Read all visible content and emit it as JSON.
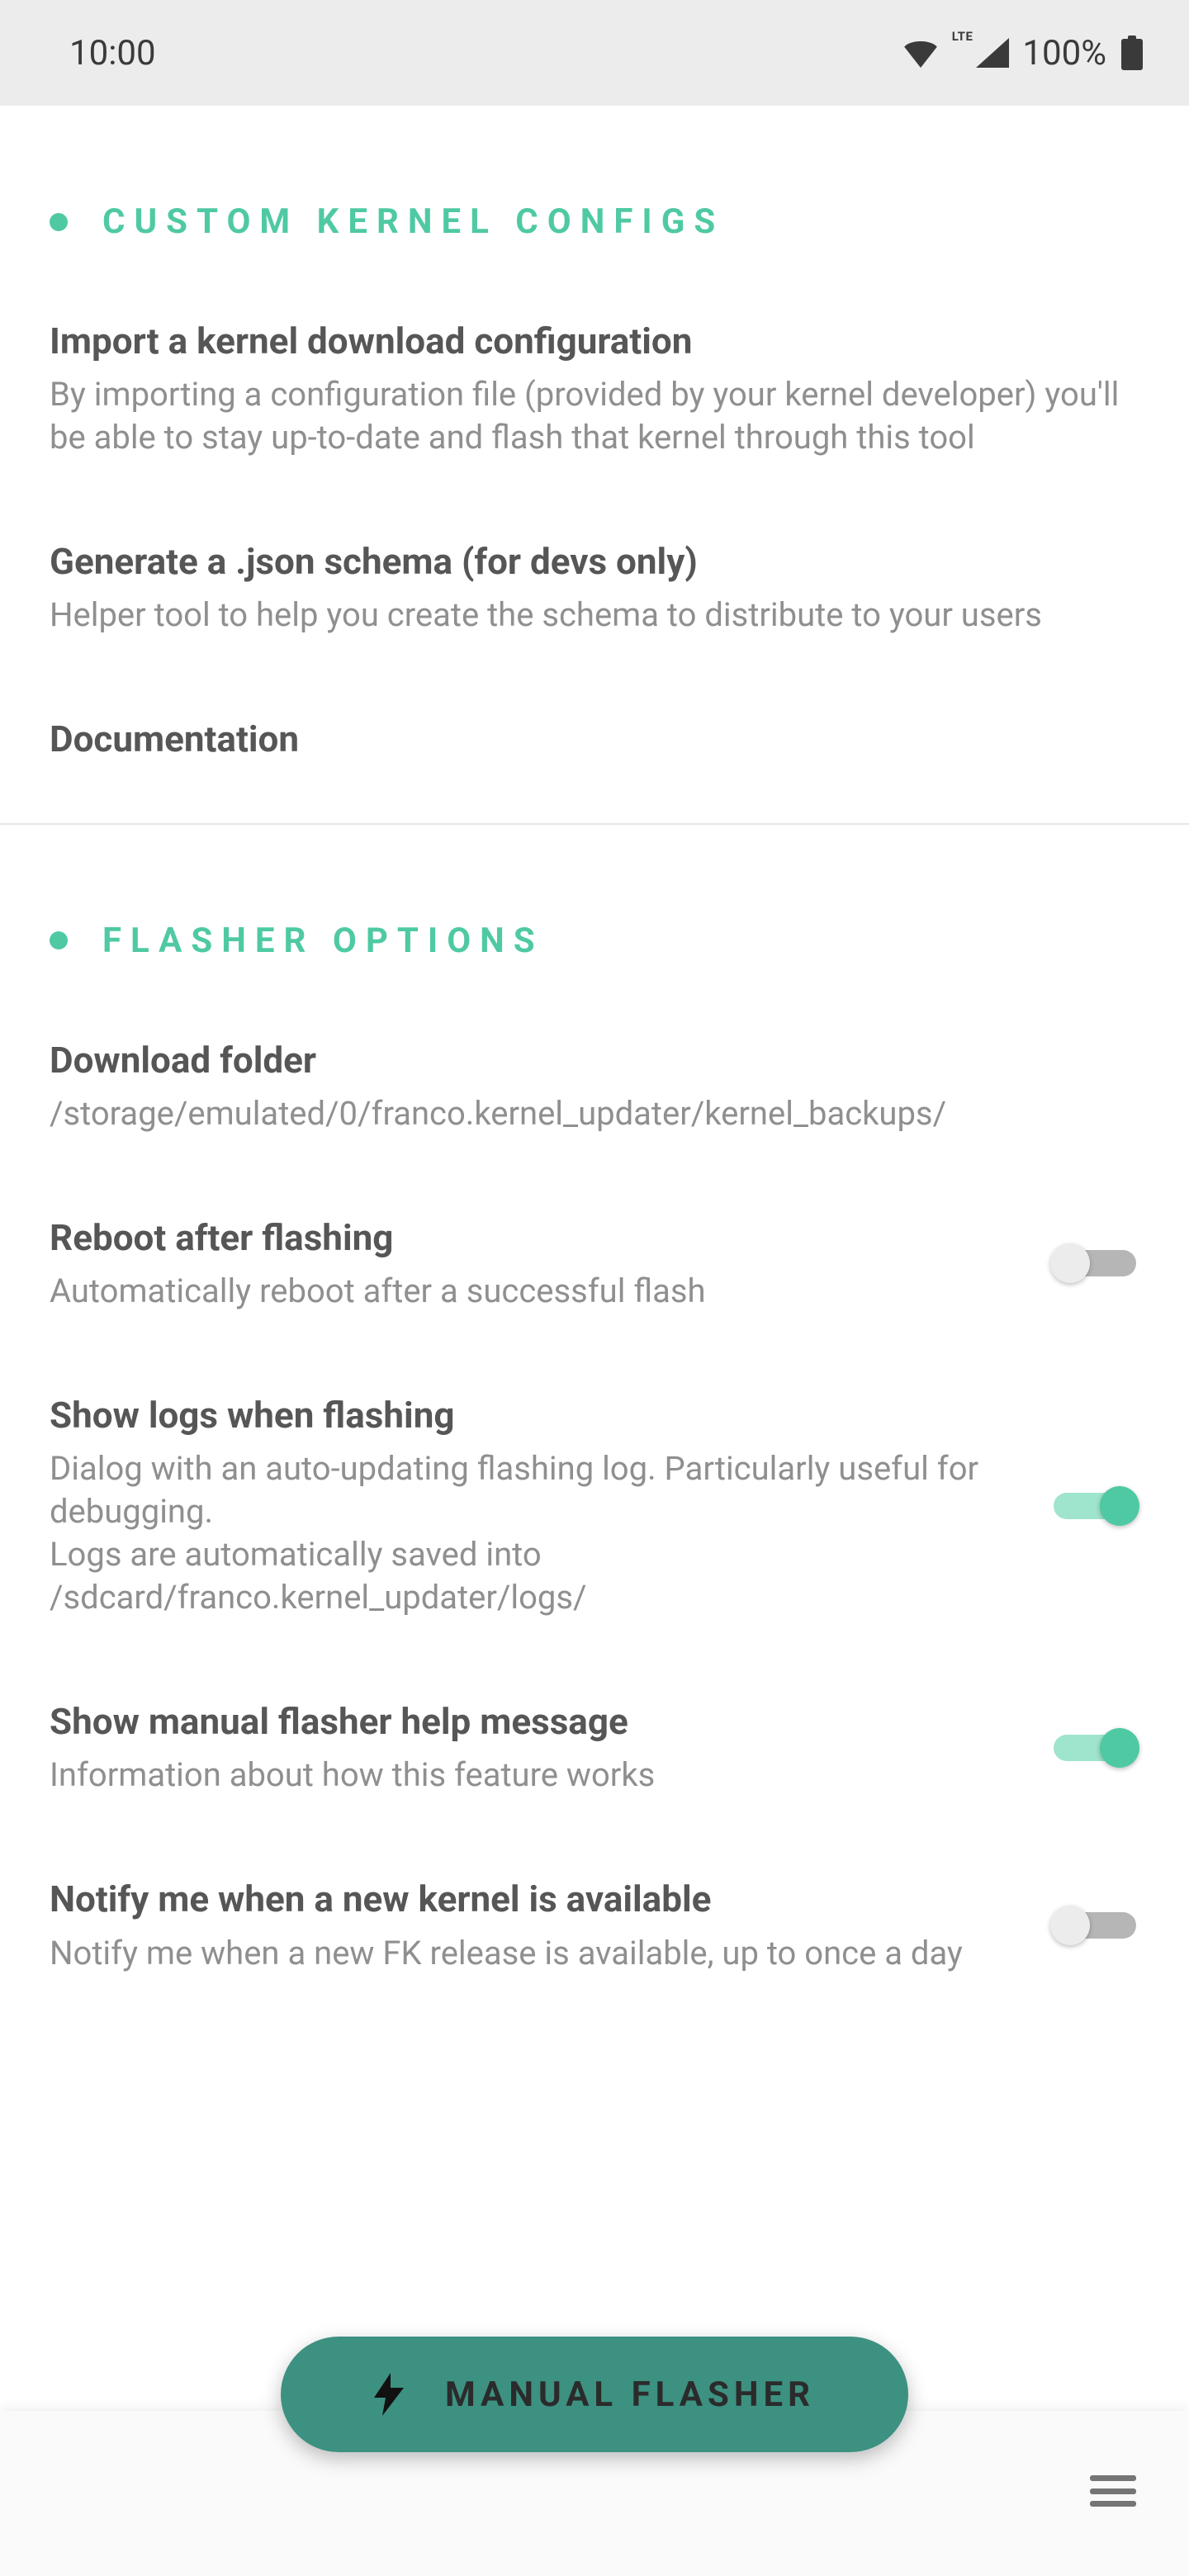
{
  "status": {
    "time": "10:00",
    "battery": "100%",
    "lte": "LTE"
  },
  "sections": [
    {
      "title": "CUSTOM KERNEL CONFIGS",
      "items": [
        {
          "title": "Import a kernel download configuration",
          "sub": "By importing a configuration file (provided by your kernel developer) you'll be able to stay up-to-date and flash that kernel through this tool"
        },
        {
          "title": "Generate a .json schema (for devs only)",
          "sub": "Helper tool to help you create the schema to distribute to your users"
        },
        {
          "title": "Documentation"
        }
      ]
    },
    {
      "title": "FLASHER OPTIONS",
      "items": [
        {
          "title": "Download folder",
          "sub": "/storage/emulated/0/franco.kernel_updater/kernel_backups/"
        },
        {
          "title": "Reboot after flashing",
          "sub": "Automatically reboot after a successful flash",
          "toggle": false
        },
        {
          "title": "Show logs when flashing",
          "sub": "Dialog with an auto-updating flashing log. Particularly useful for debugging.\nLogs are automatically saved into /sdcard/franco.kernel_updater/logs/",
          "toggle": true
        },
        {
          "title": "Show manual flasher help message",
          "sub": "Information about how this feature works",
          "toggle": true
        },
        {
          "title": "Notify me when a new kernel is available",
          "sub": "Notify me when a new FK release is available, up to once a day",
          "toggle": false
        }
      ]
    }
  ],
  "fab": {
    "label": "MANUAL FLASHER"
  }
}
